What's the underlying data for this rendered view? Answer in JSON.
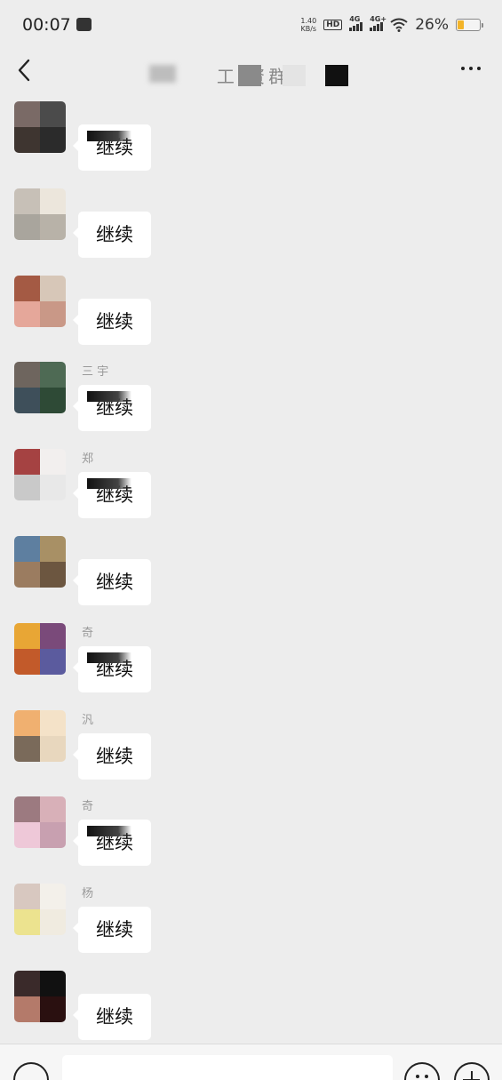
{
  "status_bar": {
    "time": "00:07",
    "net_speed_value": "1.40",
    "net_speed_unit": "KB/s",
    "hd_label": "HD",
    "sim1_label": "4G",
    "sim2_label": "4G+",
    "battery_percent": "26%",
    "battery_level": 0.26,
    "battery_color": "#f3b429"
  },
  "nav": {
    "title": "工 资群",
    "back_icon": "chevron-left-icon",
    "more_icon": "more-dots-icon"
  },
  "messages": [
    {
      "sender": "",
      "text": "继续",
      "avatar_colors": [
        "#7a6a66",
        "#4b4b4b",
        "#3e3530",
        "#2b2b2b"
      ],
      "redacted": true
    },
    {
      "sender": "",
      "text": "继续",
      "avatar_colors": [
        "#c7c0b7",
        "#ece6dc",
        "#a9a59d",
        "#b8b2a8"
      ],
      "redacted": false
    },
    {
      "sender": "",
      "text": "继续",
      "avatar_colors": [
        "#a45a44",
        "#d7c7b8",
        "#e5a79a",
        "#c99887"
      ],
      "redacted": false
    },
    {
      "sender": "三 宇",
      "text": "继续",
      "avatar_colors": [
        "#6e655e",
        "#4e6a54",
        "#3e4f5a",
        "#2e4a36"
      ],
      "redacted": true
    },
    {
      "sender": "郑 ",
      "text": "继续",
      "avatar_colors": [
        "#a54242",
        "#f2efee",
        "#c9c9c9",
        "#e8e8e8"
      ],
      "redacted": true
    },
    {
      "sender": "",
      "text": "继续",
      "avatar_colors": [
        "#5e7fa0",
        "#a89065",
        "#9b7c60",
        "#6c5640"
      ],
      "redacted": false
    },
    {
      "sender": " 奇",
      "text": "继续",
      "avatar_colors": [
        "#e8a635",
        "#7a4a7a",
        "#c25a2a",
        "#5b5b9e"
      ],
      "redacted": true
    },
    {
      "sender": "汎",
      "text": "继续",
      "avatar_colors": [
        "#f0b070",
        "#f4e2c8",
        "#7a6a5a",
        "#e8d7be"
      ],
      "redacted": false
    },
    {
      "sender": " 奇",
      "text": "继续",
      "avatar_colors": [
        "#9c7a80",
        "#d8b0b8",
        "#eec8d8",
        "#c8a0b0"
      ],
      "redacted": true
    },
    {
      "sender": "杨",
      "text": "继续",
      "avatar_colors": [
        "#d8c8c0",
        "#f3f0ea",
        "#ece38f",
        "#f0ebe0"
      ],
      "redacted": false
    },
    {
      "sender": "",
      "text": "继续",
      "avatar_colors": [
        "#3a2a2a",
        "#111111",
        "#b47a6a",
        "#2a1010"
      ],
      "redacted": false
    }
  ],
  "input_bar": {
    "voice_icon": "voice-icon",
    "input_value": "",
    "emoji_icon": "emoji-icon",
    "plus_icon": "plus-icon"
  }
}
